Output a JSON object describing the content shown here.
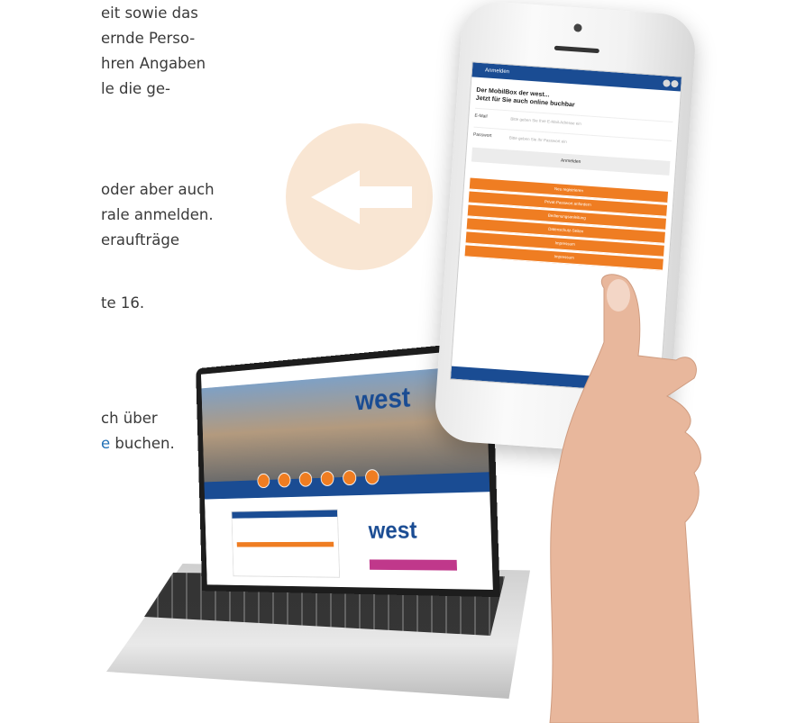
{
  "left_text": {
    "line1": "eit sowie das",
    "line2": "ernde Perso-",
    "line3": "hren Angaben",
    "line4": "le die ge-",
    "line5": "oder aber auch",
    "line6": "rale anmelden.",
    "line7": "eraufträge",
    "line8": "te 16.",
    "line9": "ch über",
    "line10_link": "e",
    "line10_rest": " buchen."
  },
  "phone": {
    "header_title": "Anmelden",
    "heading_line1": "Der MobilBox der west...",
    "heading_line2": "Jetzt für Sie auch online buchbar",
    "email_label": "E-Mail",
    "email_placeholder": "Bitte geben Sie Ihre E-Mail-Adresse ein",
    "password_label": "Passwort",
    "password_placeholder": "Bitte geben Sie Ihr Passwort ein",
    "login_button": "Anmelden",
    "menu": [
      "Neu registrieren",
      "Privat-Passwort anfordern",
      "Bedienungsanleitung",
      "Datenschutz-Seiten",
      "Impressum",
      "Impressum"
    ]
  },
  "laptop": {
    "logo_text": "west",
    "logo_text2": "west"
  },
  "colors": {
    "brand_blue": "#1a4c93",
    "brand_orange": "#ef7d22",
    "arrow_circle": "#f9e6d3"
  }
}
